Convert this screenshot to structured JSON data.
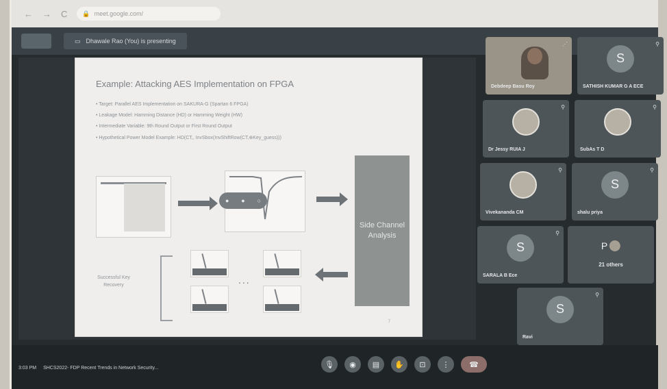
{
  "browser": {
    "nav_back": "←",
    "nav_forward": "→",
    "nav_reload": "C",
    "url": "meet.google.com/"
  },
  "meet": {
    "logo_label": "",
    "presenting_banner": "Dhawale Rao (You) is presenting",
    "present_icon": "screen-share-icon"
  },
  "slide": {
    "title": "Example: Attacking AES Implementation on FPGA",
    "bullets": [
      "Target: Parallel AES Implementation on SAKURA-G (Spartan 6 FPGA)",
      "Leakage Model: Hamming Distance (HD) or Hamming Weight (HW)",
      "Intermediate Variable: 9th Round Output or First Round Output",
      "Hypothetical Power Model Example: HD(CT,, InvSbox(InvShiftRow(CT,⊕Key_guess)))"
    ],
    "side_channel_label": "Side Channel Analysis",
    "key_recovery_label": "Successful Key Recovery",
    "ellipsis": "...",
    "page_number": "7"
  },
  "participants": [
    {
      "name": "Debdeep Basu Roy",
      "kind": "video",
      "avatar": ""
    },
    {
      "name": "SATHISH KUMAR G A ECE",
      "kind": "letter",
      "avatar": "S"
    },
    {
      "name": "Dr Jessy RUIA J",
      "kind": "photo",
      "avatar": ""
    },
    {
      "name": "SubAs T D",
      "kind": "photo",
      "avatar": ""
    },
    {
      "name": "Vivekananda CM",
      "kind": "photo",
      "avatar": ""
    },
    {
      "name": "shalu priya",
      "kind": "letter",
      "avatar": "S"
    },
    {
      "name": "SARALA B Ece",
      "kind": "letter",
      "avatar": "S"
    },
    {
      "name": "21 others",
      "kind": "others",
      "avatar": "P"
    },
    {
      "name": "Ravi",
      "kind": "letter",
      "avatar": "S"
    }
  ],
  "bottom": {
    "time": "3:03 PM",
    "meeting_title": "SHCS2022- FDP Recent Trends in Network Security..."
  },
  "controls": [
    {
      "id": "mic",
      "icon": "mic-icon",
      "glyph": "🎙"
    },
    {
      "id": "camera",
      "icon": "camera-icon",
      "glyph": "◉"
    },
    {
      "id": "captions",
      "icon": "captions-icon",
      "glyph": "▤"
    },
    {
      "id": "hand",
      "icon": "raise-hand-icon",
      "glyph": "✋"
    },
    {
      "id": "present",
      "icon": "present-icon",
      "glyph": "⊡"
    },
    {
      "id": "more",
      "icon": "more-options-icon",
      "glyph": "⋮"
    },
    {
      "id": "end",
      "icon": "end-call-icon",
      "glyph": "☎"
    }
  ]
}
